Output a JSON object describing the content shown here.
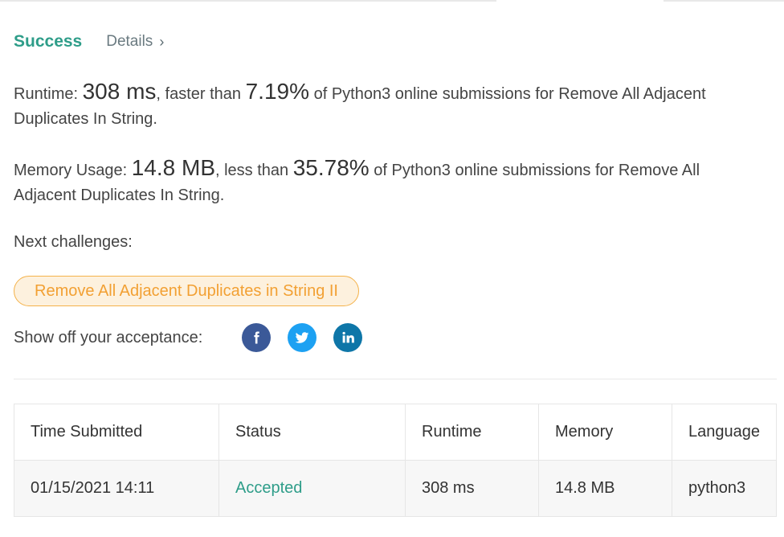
{
  "header": {
    "status_title": "Success",
    "details_label": "Details",
    "details_chevron": "›"
  },
  "runtime": {
    "label": "Runtime:",
    "value": "308 ms",
    "connector": ", faster than",
    "percent": "7.19%",
    "suffix": "of Python3 online submissions for Remove All Adjacent Duplicates In String."
  },
  "memory": {
    "label": "Memory Usage:",
    "value": "14.8 MB",
    "connector": ", less than",
    "percent": "35.78%",
    "suffix": "of Python3 online submissions for Remove All Adjacent Duplicates In String."
  },
  "next_challenges": {
    "label": "Next challenges:",
    "items": [
      "Remove All Adjacent Duplicates in String II"
    ]
  },
  "share": {
    "label": "Show off your acceptance:",
    "buttons": [
      {
        "icon": "facebook-icon",
        "color": "#3b5998"
      },
      {
        "icon": "twitter-icon",
        "color": "#1da1f2"
      },
      {
        "icon": "linkedin-icon",
        "color": "#0e76a8"
      }
    ]
  },
  "submissions": {
    "headers": [
      "Time Submitted",
      "Status",
      "Runtime",
      "Memory",
      "Language"
    ],
    "rows": [
      [
        "01/15/2021 14:11",
        "Accepted",
        "308 ms",
        "14.8 MB",
        "python3"
      ]
    ]
  },
  "colors": {
    "success": "#2e9d89",
    "challenge_text": "#f2a033",
    "challenge_bg": "#fdf1de"
  }
}
